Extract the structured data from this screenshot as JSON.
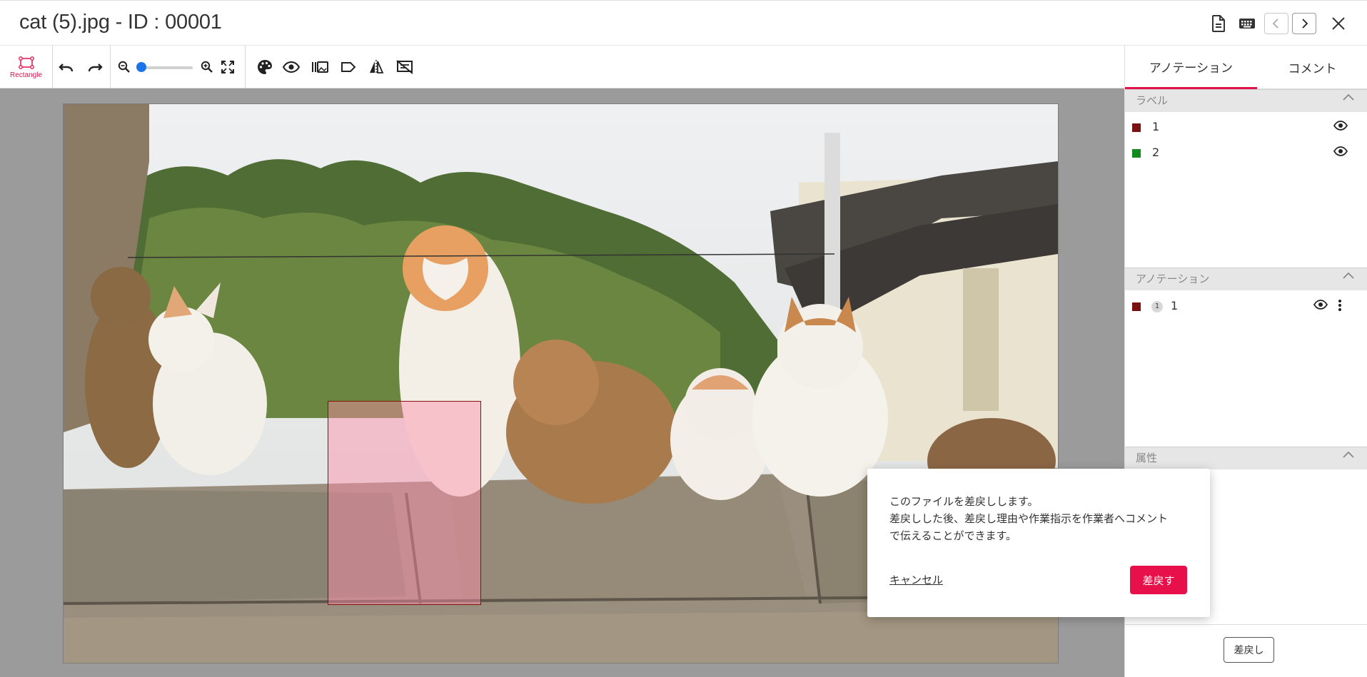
{
  "header": {
    "title": "cat (5).jpg - ID : 00001",
    "icons": [
      "document-icon",
      "keyboard-icon",
      "chevron-left-icon",
      "chevron-right-icon",
      "close-icon"
    ]
  },
  "toolbar": {
    "active_tool_label": "Rectangle",
    "zoom_level": 0.0,
    "icons": [
      "undo-icon",
      "redo-icon",
      "zoom-out-icon",
      "zoom-in-icon",
      "fit-screen-icon",
      "palette-icon",
      "eye-icon",
      "bars-icon",
      "label-icon",
      "flip-icon",
      "hide-labels-icon"
    ]
  },
  "colors": {
    "accent": "#e0134c",
    "label1": "#7b1010",
    "label2": "#128a1e",
    "slider": "#1a73e8"
  },
  "panel": {
    "tabs": [
      {
        "label": "アノテーション",
        "active": true
      },
      {
        "label": "コメント",
        "active": false
      }
    ],
    "labels_header": "ラベル",
    "labels": [
      {
        "name": "1",
        "color": "#7b1010"
      },
      {
        "name": "2",
        "color": "#128a1e"
      }
    ],
    "annotations_header": "アノテーション",
    "annotations": [
      {
        "index": "1",
        "label": "1",
        "color": "#7b1010"
      }
    ],
    "attributes_header": "属性",
    "return_button": "差戻し"
  },
  "popover": {
    "message_line1": "このファイルを差戻しします。",
    "message_line2": "差戻しした後、差戻し理由や作業指示を作業者へコメント",
    "message_line3": "で伝えることができます。",
    "cancel_label": "キャンセル",
    "confirm_label": "差戻す"
  }
}
